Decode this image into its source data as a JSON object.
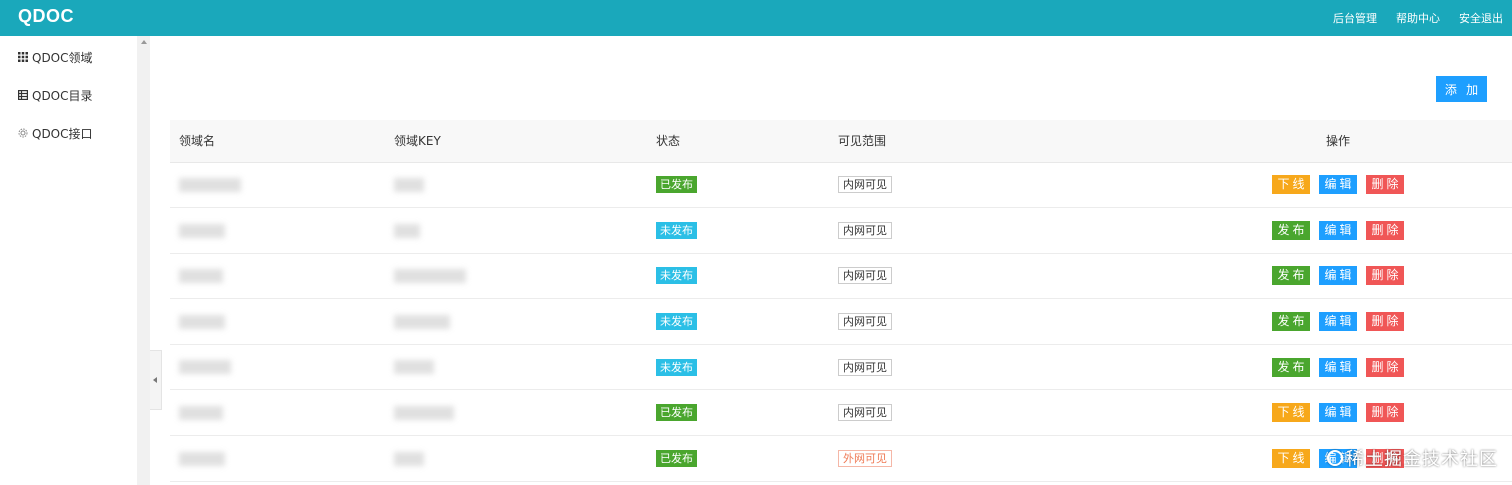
{
  "header": {
    "logo": "QDOC",
    "nav": [
      "后台管理",
      "帮助中心",
      "安全退出"
    ]
  },
  "sidebar": {
    "items": [
      {
        "label": "QDOC领域",
        "icon": "grid-icon"
      },
      {
        "label": "QDOC目录",
        "icon": "table-icon"
      },
      {
        "label": "QDOC接口",
        "icon": "gear-icon"
      }
    ]
  },
  "toolbar": {
    "add_label": "添 加"
  },
  "table": {
    "columns": [
      "领域名",
      "领域KEY",
      "状态",
      "可见范围",
      "操作"
    ],
    "rows": [
      {
        "status": "已发布",
        "status_type": "published",
        "scope": "内网可见",
        "scope_type": "internal",
        "actions": [
          "下线",
          "编辑",
          "删除"
        ]
      },
      {
        "status": "未发布",
        "status_type": "unpublished",
        "scope": "内网可见",
        "scope_type": "internal",
        "actions": [
          "发布",
          "编辑",
          "删除"
        ]
      },
      {
        "status": "未发布",
        "status_type": "unpublished",
        "scope": "内网可见",
        "scope_type": "internal",
        "actions": [
          "发布",
          "编辑",
          "删除"
        ]
      },
      {
        "status": "未发布",
        "status_type": "unpublished",
        "scope": "内网可见",
        "scope_type": "internal",
        "actions": [
          "发布",
          "编辑",
          "删除"
        ]
      },
      {
        "status": "未发布",
        "status_type": "unpublished",
        "scope": "内网可见",
        "scope_type": "internal",
        "actions": [
          "发布",
          "编辑",
          "删除"
        ]
      },
      {
        "status": "已发布",
        "status_type": "published",
        "scope": "内网可见",
        "scope_type": "internal",
        "actions": [
          "下线",
          "编辑",
          "删除"
        ]
      },
      {
        "status": "已发布",
        "status_type": "published",
        "scope": "外网可见",
        "scope_type": "external",
        "actions": [
          "下线",
          "编辑",
          "删除"
        ]
      }
    ]
  },
  "watermark": "稀土掘金技术社区",
  "colors": {
    "header": "#1aa8bb",
    "primary": "#1e9fff",
    "published": "#4aa62e",
    "unpublished": "#2bbfe6",
    "offline": "#f7a81b",
    "delete": "#f05656"
  }
}
